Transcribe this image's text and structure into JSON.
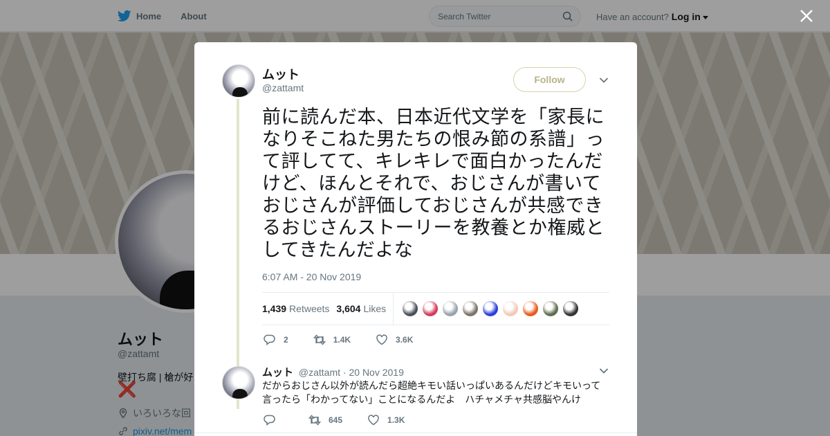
{
  "nav": {
    "home": "Home",
    "about": "About",
    "search_placeholder": "Search Twitter",
    "have_account": "Have an account?",
    "login": "Log in"
  },
  "profile": {
    "name": "ムット",
    "handle": "@zattamt",
    "bio": "壁打ち腐 | 槍が好",
    "bio_mark": "❌",
    "location": "いろいろな回",
    "link": "pixiv.net/mem"
  },
  "tweet": {
    "name": "ムット",
    "handle": "@zattamt",
    "follow": "Follow",
    "text": "前に読んだ本、日本近代文学を「家長になりそこねた男たちの恨み節の系譜」って評してて、キレキレで面白かったんだけど、ほんとそれで、おじさんが書いておじさんが評価しておじさんが共感できるおじさんストーリーを教養とか権威としてきたんだよな",
    "time": "6:07 AM - 20 Nov 2019",
    "retweets_count": "1,439",
    "retweets_label": "Retweets",
    "likes_count": "3,604",
    "likes_label": "Likes",
    "liker_colors": [
      "#4a4f5a",
      "#d33c5a",
      "#9aa3ad",
      "#7b7468",
      "#2a3fd8",
      "#f1c9b8",
      "#e85a1e",
      "#5d6e4e",
      "#333333"
    ],
    "actions": {
      "replies": "2",
      "retweets": "1.4K",
      "likes": "3.6K"
    }
  },
  "reply": {
    "name": "ムット",
    "handle": "@zattamt",
    "dot": "·",
    "date": "20 Nov 2019",
    "text": "だからおじさん以外が読んだら超絶キモい話いっぱいあるんだけどキモいって言ったら「わかってない」ことになるんだよ　ハチャメチャ共感脳やんけ",
    "actions": {
      "replies": "",
      "retweets": "645",
      "likes": "1.3K"
    }
  },
  "icons": [
    "twitter-bird-icon",
    "search-icon",
    "close-icon",
    "chevron-down-icon",
    "reply-icon",
    "retweet-icon",
    "heart-icon",
    "location-icon",
    "link-icon"
  ],
  "colors": {
    "accent": "#1da1f2",
    "follow_border": "#d7d3a8",
    "thread_line": "#e1e6ca"
  }
}
